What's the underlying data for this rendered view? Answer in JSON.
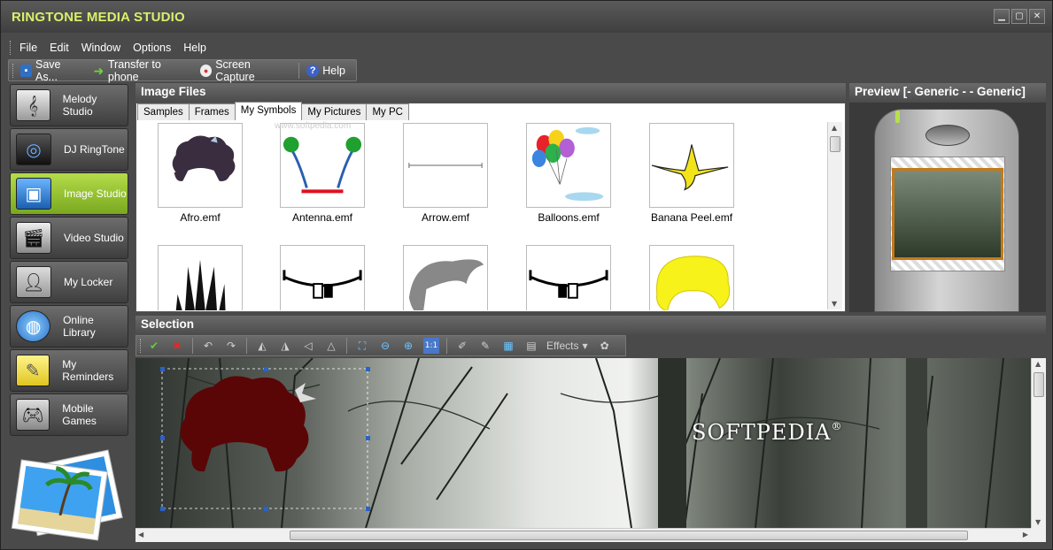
{
  "app": {
    "title": "RINGTONE MEDIA STUDIO"
  },
  "menu": [
    "File",
    "Edit",
    "Window",
    "Options",
    "Help"
  ],
  "toolbar": {
    "save_as": "Save As...",
    "transfer": "Transfer to phone",
    "screen_capture": "Screen Capture",
    "help": "Help"
  },
  "sidebar": {
    "items": [
      {
        "label": "Melody Studio",
        "icon": "melody-icon"
      },
      {
        "label": "DJ RingTone",
        "icon": "dj-icon"
      },
      {
        "label": "Image Studio",
        "icon": "image-icon",
        "active": true
      },
      {
        "label": "Video Studio",
        "icon": "video-icon"
      },
      {
        "label": "My Locker",
        "icon": "locker-icon"
      },
      {
        "label": "Online Library",
        "icon": "globe-icon"
      },
      {
        "label": "My Reminders",
        "icon": "reminder-icon"
      },
      {
        "label": "Mobile Games",
        "icon": "gamepad-icon"
      }
    ]
  },
  "files": {
    "title": "Image Files",
    "tabs": [
      "Samples",
      "Frames",
      "My Symbols",
      "My Pictures",
      "My PC"
    ],
    "active_tab": "My Symbols",
    "row1": [
      "Afro.emf",
      "Antenna.emf",
      "Arrow.emf",
      "Balloons.emf",
      "Banana Peel.emf"
    ],
    "watermark": "www.softpedia.com"
  },
  "preview": {
    "title": "Preview [- Generic - - Generic]"
  },
  "selection": {
    "title": "Selection",
    "effects_label": "Effects",
    "canvas_text": "SOFTPEDIA",
    "trademark": "®"
  },
  "colors": {
    "accent": "#d8f06a",
    "active": "#9fcb38"
  }
}
